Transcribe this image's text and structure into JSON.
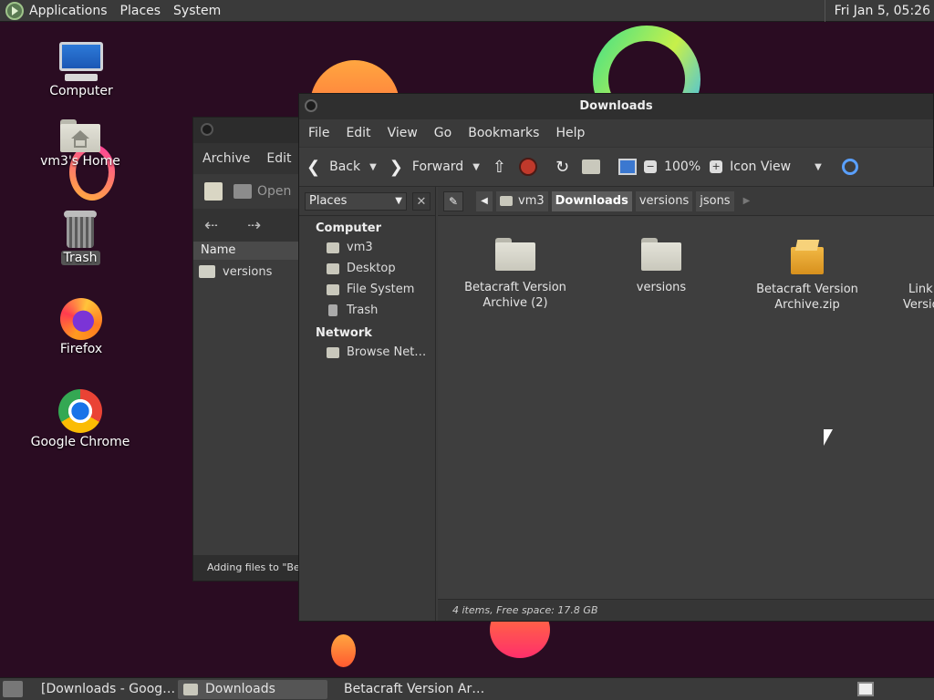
{
  "top_panel": {
    "menus": [
      "Applications",
      "Places",
      "System"
    ],
    "clock": "Fri Jan  5, 05:26"
  },
  "desktop_icons": {
    "computer": "Computer",
    "home": "vm3's Home",
    "trash": "Trash",
    "firefox": "Firefox",
    "chrome": "Google Chrome"
  },
  "archive_window": {
    "menus": [
      "Archive",
      "Edit"
    ],
    "open_label": "Open",
    "column_name": "Name",
    "rows": [
      "versions"
    ],
    "status": "Adding files to \"Beta"
  },
  "file_manager": {
    "title": "Downloads",
    "menus": [
      "File",
      "Edit",
      "View",
      "Go",
      "Bookmarks",
      "Help"
    ],
    "toolbar": {
      "back": "Back",
      "forward": "Forward",
      "zoom": "100%",
      "view_mode": "Icon View"
    },
    "sidebar": {
      "selector": "Places",
      "sections": [
        {
          "title": "Computer",
          "items": [
            "vm3",
            "Desktop",
            "File System",
            "Trash"
          ]
        },
        {
          "title": "Network",
          "items": [
            "Browse Net…"
          ]
        }
      ]
    },
    "pathbar": [
      "vm3",
      "Downloads",
      "versions",
      "jsons"
    ],
    "files": [
      {
        "name_line1": "Betacraft Version",
        "name_line2": "Archive (2)",
        "icon": "folder-icon"
      },
      {
        "name_line1": "versions",
        "name_line2": "",
        "icon": "folder-icon"
      },
      {
        "name_line1": "Betacraft Version",
        "name_line2": "Archive.zip",
        "icon": "zip-icon"
      },
      {
        "name_line1": "Link",
        "name_line2": "Versio",
        "icon": "file-icon"
      }
    ],
    "status": "4 items, Free space: 17.8 GB"
  },
  "taskbar": {
    "tasks": [
      "[Downloads - Goog…",
      "Downloads",
      "Betacraft Version Ar…"
    ]
  }
}
